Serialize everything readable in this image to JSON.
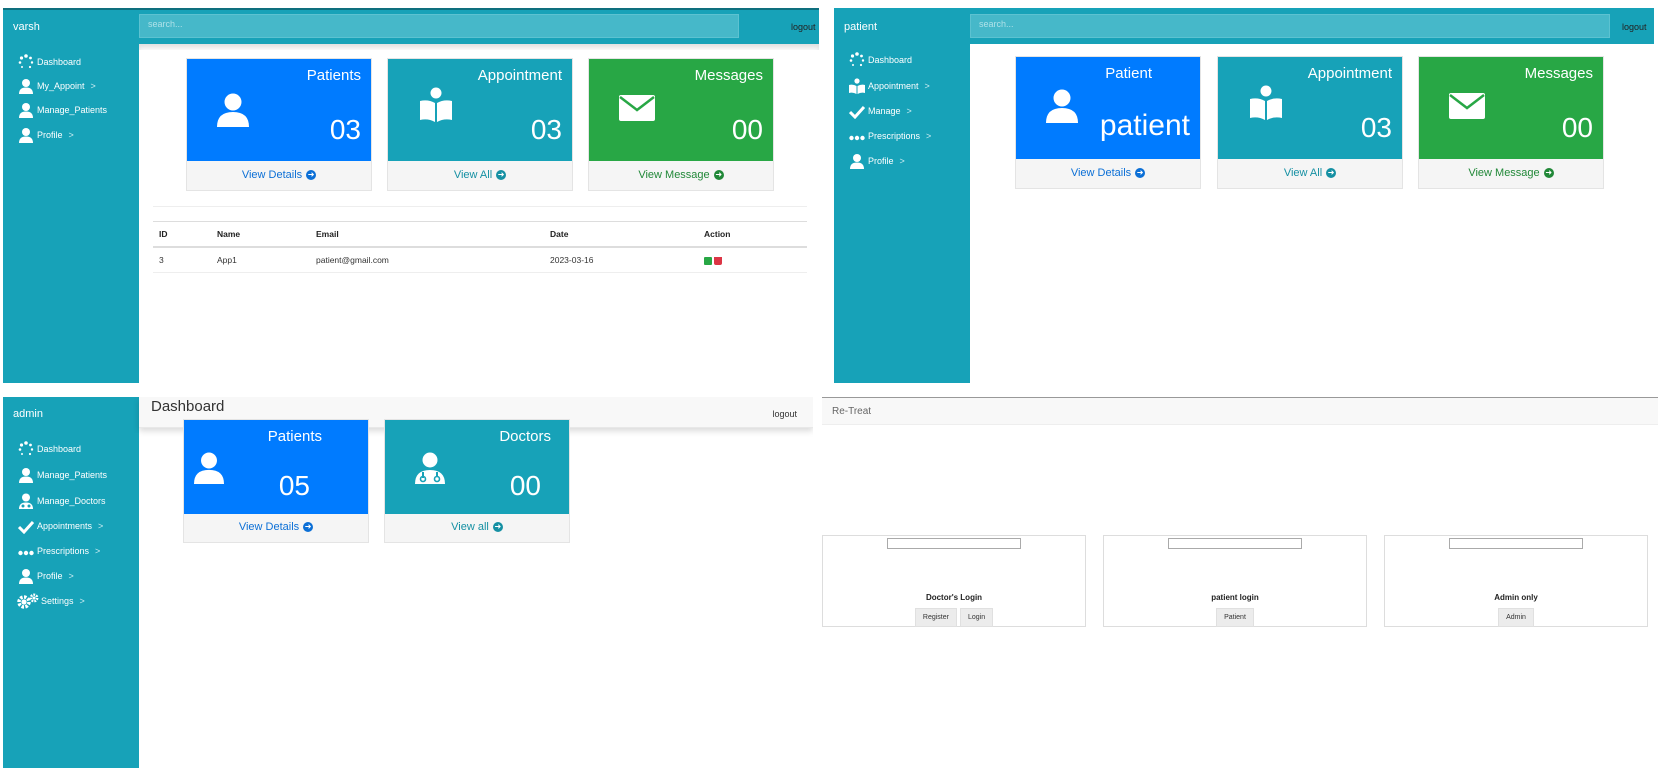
{
  "doctor_panel": {
    "brand": "varsh",
    "search_placeholder": "search...",
    "logout": "logout",
    "nav": [
      {
        "label": "Dashboard",
        "icon": "spinner-icon",
        "chevron": ""
      },
      {
        "label": "My_Appoint",
        "icon": "user-icon",
        "chevron": ">"
      },
      {
        "label": "Manage_Patients",
        "icon": "user-icon",
        "chevron": ""
      },
      {
        "label": "Profile",
        "icon": "user-icon",
        "chevron": ">"
      }
    ],
    "cards": [
      {
        "label": "Patients",
        "value": "03",
        "link": "View Details",
        "color": "#007bff",
        "icon": "user-icon"
      },
      {
        "label": "Appointment",
        "value": "03",
        "link": "View All",
        "color": "#17a2b8",
        "icon": "book-icon"
      },
      {
        "label": "Messages",
        "value": "00",
        "link": "View Message",
        "color": "#28a745",
        "icon": "envelope-icon"
      }
    ],
    "table": {
      "headers": [
        "ID",
        "Name",
        "Email",
        "Date",
        "Action"
      ],
      "rows": [
        {
          "id": "3",
          "name": "App1",
          "email": "patient@gmail.com",
          "date": "2023-03-16"
        }
      ]
    }
  },
  "patient_panel": {
    "brand": "patient",
    "search_placeholder": "search...",
    "logout": "logout",
    "nav": [
      {
        "label": "Dashboard",
        "icon": "spinner-icon",
        "chevron": ""
      },
      {
        "label": "Appointment",
        "icon": "book-icon",
        "chevron": ">"
      },
      {
        "label": "Manage",
        "icon": "check-icon",
        "chevron": ">"
      },
      {
        "label": "Prescriptions",
        "icon": "dots-icon",
        "chevron": ">"
      },
      {
        "label": "Profile",
        "icon": "user-icon",
        "chevron": ">"
      }
    ],
    "cards": [
      {
        "label": "Patient",
        "value": "patient",
        "link": "View Details",
        "color": "#007bff",
        "icon": "user-icon"
      },
      {
        "label": "Appointment",
        "value": "03",
        "link": "View All",
        "color": "#17a2b8",
        "icon": "book-icon"
      },
      {
        "label": "Messages",
        "value": "00",
        "link": "View Message",
        "color": "#28a745",
        "icon": "envelope-icon"
      }
    ]
  },
  "admin_panel": {
    "brand": "admin",
    "title": "Dashboard",
    "logout": "logout",
    "nav": [
      {
        "label": "Dashboard",
        "icon": "spinner-icon",
        "chevron": ""
      },
      {
        "label": "Manage_Patients",
        "icon": "user-icon",
        "chevron": ""
      },
      {
        "label": "Manage_Doctors",
        "icon": "doctor-icon",
        "chevron": ""
      },
      {
        "label": "Appointments",
        "icon": "check-icon",
        "chevron": ">"
      },
      {
        "label": "Prescriptions",
        "icon": "dots-icon",
        "chevron": ">"
      },
      {
        "label": "Profile",
        "icon": "user-icon",
        "chevron": ">"
      },
      {
        "label": "Settings",
        "icon": "gears-icon",
        "chevron": ">"
      }
    ],
    "cards": [
      {
        "label": "Patients",
        "value": "05",
        "link": "View Details",
        "color": "#007bff",
        "icon": "user-icon"
      },
      {
        "label": "Doctors",
        "value": "00",
        "link": "View all",
        "color": "#17a2b8",
        "icon": "doctor-icon"
      }
    ]
  },
  "login_page": {
    "brand": "Re-Treat",
    "cards": [
      {
        "title": "Doctor's Login",
        "buttons": [
          "Register",
          "Login"
        ]
      },
      {
        "title": "patient login",
        "buttons": [
          "Patient"
        ]
      },
      {
        "title": "Admin only",
        "buttons": [
          "Admin"
        ]
      }
    ]
  }
}
